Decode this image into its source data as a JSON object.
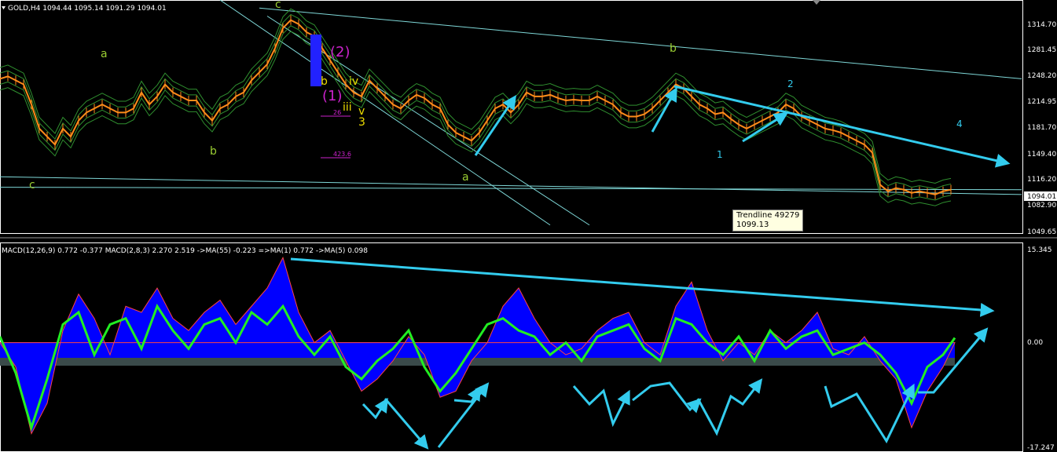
{
  "header": {
    "main_title": "GOLD,H4 1094.44 1095.14 1091.29 1094.01",
    "macd_title": "MACD(12,26,9) 0.772 -0.377  MACD(2,8,3) 2.270 2.519  ->MA(55) -0.223  =>MA(1) 0.772  ->MA(5) 0.098"
  },
  "tooltip": {
    "line1": "Trendline 49279",
    "line2": "1099.13"
  },
  "colors": {
    "background": "#000000",
    "candle": "#ff8c1a",
    "envelope": "#2f8f2f",
    "trendline": "#7fd8d8",
    "arrow": "#33ccee",
    "wave_green": "#9acd32",
    "wave_cyan": "#33ccee",
    "wave_magenta": "#cc22cc",
    "wave_yellow": "#eedd00",
    "macd_fill": "#0000ff",
    "macd_line": "#22ee22",
    "zero_band": "#0000ff",
    "neg_band": "#3a4a4a"
  },
  "price_axis": {
    "ticks": [
      "1314.70",
      "1281.45",
      "1248.20",
      "1214.95",
      "1181.70",
      "1149.40",
      "1116.20",
      "1082.90",
      "1049.65"
    ],
    "current": "1094.01"
  },
  "macd_axis": {
    "ticks": [
      "15.345",
      "0.00",
      "-17.247"
    ]
  },
  "wave_labels": [
    {
      "text": "c",
      "color": "wave_green"
    },
    {
      "text": "a",
      "color": "wave_green"
    },
    {
      "text": "b",
      "color": "wave_green"
    },
    {
      "text": "c",
      "color": "wave_green"
    },
    {
      "text": "b",
      "color": "wave_green"
    },
    {
      "text": "a",
      "color": "wave_green"
    },
    {
      "text": "1",
      "color": "wave_cyan"
    },
    {
      "text": "2",
      "color": "wave_cyan"
    },
    {
      "text": "4",
      "color": "wave_cyan"
    },
    {
      "text": "iii",
      "color": "wave_yellow"
    },
    {
      "text": "v",
      "color": "wave_yellow"
    },
    {
      "text": "3",
      "color": "wave_yellow"
    },
    {
      "text": "(1)",
      "color": "wave_magenta"
    },
    {
      "text": "(2)",
      "color": "wave_magenta"
    },
    {
      "text": "b",
      "color": "wave_yellow"
    },
    {
      "text": "iv",
      "color": "wave_yellow"
    }
  ],
  "fib_labels": [
    "26",
    "423.6"
  ],
  "chart_data": [
    {
      "type": "line",
      "title": "GOLD,H4 1094.44 1095.14 1091.29 1094.01",
      "ylim": [
        1040,
        1330
      ],
      "y_ticks": [
        1314.7,
        1281.45,
        1248.2,
        1214.95,
        1181.7,
        1149.4,
        1116.2,
        1082.9,
        1049.65
      ],
      "series": [
        {
          "name": "GOLD,H4",
          "x": [
            0,
            10,
            20,
            30,
            40,
            50,
            60,
            70,
            80,
            90,
            100,
            110,
            120,
            130,
            140,
            150,
            160,
            170,
            180,
            190,
            200,
            210,
            220,
            230,
            240,
            250,
            260,
            270,
            280,
            290,
            300,
            310,
            320,
            330,
            340,
            350,
            360,
            370,
            380,
            390,
            400,
            410,
            420,
            430,
            440,
            450,
            460,
            470,
            480,
            490,
            500,
            510,
            520,
            530,
            540,
            550,
            560,
            570,
            580,
            590,
            600,
            610,
            620,
            630,
            640,
            650,
            660,
            670,
            680,
            690,
            700,
            710,
            720,
            730,
            740,
            750,
            760,
            770,
            780,
            790,
            800,
            810,
            820,
            830,
            840,
            850,
            860,
            870,
            880,
            890,
            900,
            910,
            920,
            930,
            940,
            950,
            960,
            970,
            980,
            990,
            1000,
            1010,
            1020,
            1030,
            1040,
            1050,
            1060,
            1070,
            1080,
            1090,
            1100,
            1110,
            1120,
            1130,
            1140,
            1150,
            1160,
            1170,
            1180,
            1190,
            1200,
            1210
          ],
          "y": [
            1232,
            1235,
            1230,
            1225,
            1200,
            1170,
            1160,
            1150,
            1170,
            1160,
            1180,
            1190,
            1195,
            1200,
            1195,
            1190,
            1190,
            1195,
            1215,
            1200,
            1210,
            1225,
            1215,
            1210,
            1205,
            1205,
            1190,
            1180,
            1195,
            1200,
            1210,
            1215,
            1230,
            1240,
            1250,
            1270,
            1295,
            1305,
            1300,
            1290,
            1285,
            1270,
            1255,
            1240,
            1225,
            1215,
            1210,
            1230,
            1220,
            1210,
            1200,
            1195,
            1205,
            1212,
            1208,
            1200,
            1195,
            1175,
            1165,
            1160,
            1155,
            1165,
            1180,
            1195,
            1200,
            1190,
            1200,
            1215,
            1210,
            1210,
            1212,
            1208,
            1205,
            1206,
            1205,
            1205,
            1210,
            1205,
            1200,
            1190,
            1185,
            1185,
            1188,
            1195,
            1205,
            1215,
            1225,
            1220,
            1210,
            1200,
            1195,
            1188,
            1190,
            1182,
            1175,
            1170,
            1175,
            1180,
            1185,
            1190,
            1200,
            1195,
            1185,
            1180,
            1175,
            1170,
            1168,
            1165,
            1160,
            1155,
            1150,
            1140,
            1100,
            1092,
            1096,
            1094,
            1090,
            1092,
            1090,
            1088,
            1092,
            1094
          ]
        }
      ]
    },
    {
      "type": "area",
      "title": "MACD(12,26,9) 0.772 -0.377  MACD(2,8,3) 2.270 2.519  ->MA(55) -0.223  =>MA(1) 0.772  ->MA(5) 0.098",
      "ylim": [
        -17.247,
        15.345
      ],
      "y_ticks": [
        15.345,
        0.0,
        -17.247
      ],
      "series": [
        {
          "name": "MACD(12,26,9)",
          "x": [
            0,
            20,
            40,
            60,
            80,
            100,
            120,
            140,
            160,
            180,
            200,
            220,
            240,
            260,
            280,
            300,
            320,
            340,
            360,
            380,
            400,
            420,
            440,
            460,
            480,
            500,
            520,
            540,
            560,
            580,
            600,
            620,
            640,
            660,
            680,
            700,
            720,
            740,
            760,
            780,
            800,
            820,
            840,
            860,
            880,
            900,
            920,
            940,
            960,
            980,
            1000,
            1020,
            1040,
            1060,
            1080,
            1100,
            1120,
            1140,
            1160,
            1180,
            1200,
            1215
          ],
          "y": [
            0,
            -4,
            -15,
            -10,
            2,
            8,
            4,
            -2,
            6,
            5,
            9,
            4,
            2,
            5,
            7,
            3,
            6,
            9,
            14,
            5,
            0,
            2,
            -3,
            -8,
            -6,
            -3,
            1,
            -2,
            -9,
            -8,
            -3,
            0,
            6,
            9,
            4,
            0,
            -2,
            -1,
            2,
            4,
            5,
            0,
            -2,
            6,
            10,
            2,
            -3,
            0,
            -2,
            2,
            0,
            2,
            5,
            -1,
            -2,
            1,
            -3,
            -6,
            -14,
            -8,
            -4,
            0
          ]
        },
        {
          "name": "MACD(2,8,3)",
          "x": [
            0,
            20,
            40,
            60,
            80,
            100,
            120,
            140,
            160,
            180,
            200,
            220,
            240,
            260,
            280,
            300,
            320,
            340,
            360,
            380,
            400,
            420,
            440,
            460,
            480,
            500,
            520,
            540,
            560,
            580,
            600,
            620,
            640,
            660,
            680,
            700,
            720,
            740,
            760,
            780,
            800,
            820,
            840,
            860,
            880,
            900,
            920,
            940,
            960,
            980,
            1000,
            1020,
            1040,
            1060,
            1080,
            1100,
            1120,
            1140,
            1160,
            1180,
            1200,
            1215
          ],
          "y": [
            1,
            -5,
            -14,
            -6,
            3,
            5,
            -2,
            3,
            4,
            -1,
            6,
            2,
            -1,
            3,
            4,
            0,
            5,
            3,
            6,
            1,
            -2,
            1,
            -4,
            -6,
            -3,
            -1,
            2,
            -4,
            -8,
            -5,
            -1,
            3,
            4,
            2,
            1,
            -2,
            0,
            -3,
            1,
            2,
            3,
            -1,
            -3,
            4,
            3,
            0,
            -2,
            1,
            -3,
            2,
            -1,
            1,
            2,
            -2,
            -1,
            0,
            -2,
            -5,
            -10,
            -4,
            -2,
            0.8
          ]
        }
      ]
    }
  ]
}
